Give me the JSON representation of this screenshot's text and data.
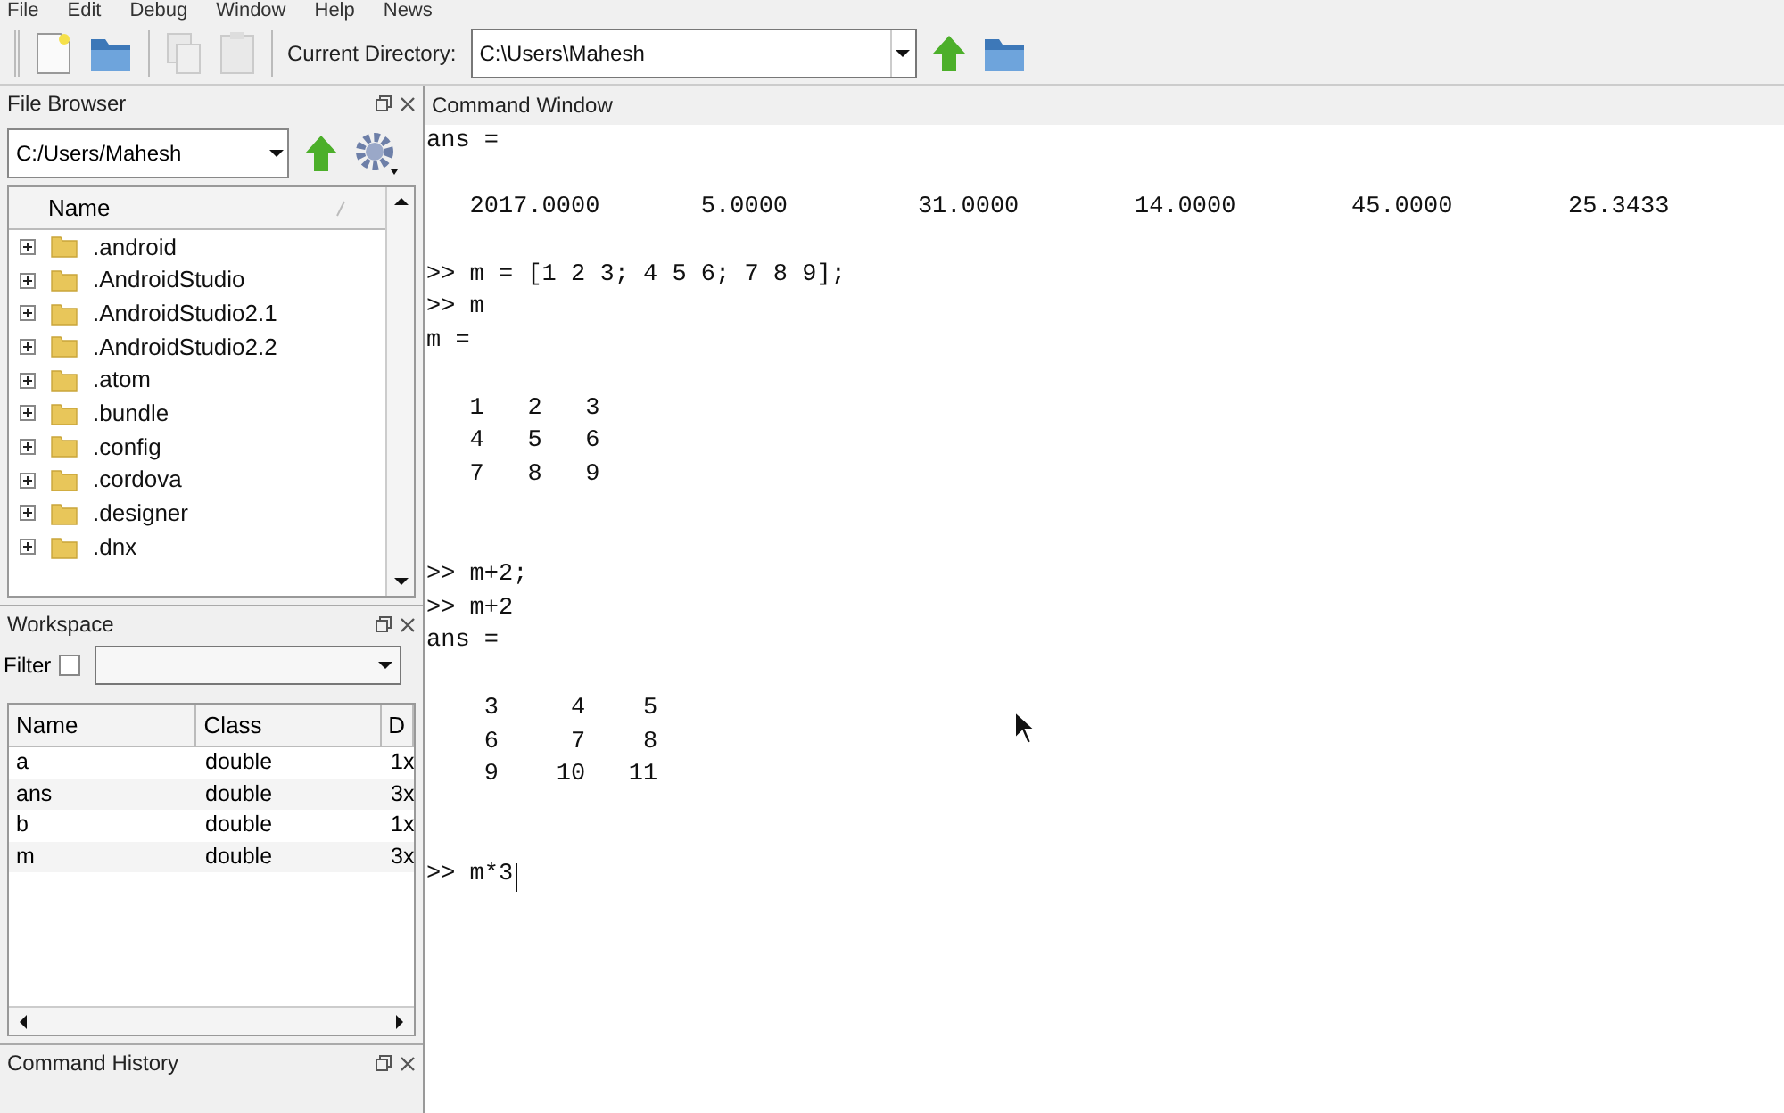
{
  "menu": [
    "File",
    "Edit",
    "Debug",
    "Window",
    "Help",
    "News"
  ],
  "toolbar": {
    "buttons": [
      {
        "kind": "new",
        "disabled": false
      },
      {
        "kind": "open",
        "disabled": false
      },
      {
        "kind": "copy",
        "disabled": true
      },
      {
        "kind": "paste",
        "disabled": true
      }
    ],
    "directory_label": "Current Directory:",
    "directory": "C:\\Users\\Mahesh"
  },
  "file_browser": {
    "title": "File Browser",
    "path": "C:/Users/Mahesh",
    "column": "Name",
    "items": [
      {
        "name": ".android",
        "expanded": false
      },
      {
        "name": ".AndroidStudio",
        "expanded": false
      },
      {
        "name": ".AndroidStudio2.1",
        "expanded": false
      },
      {
        "name": ".AndroidStudio2.2",
        "expanded": false
      },
      {
        "name": ".atom",
        "expanded": false
      },
      {
        "name": ".bundle",
        "expanded": false
      },
      {
        "name": ".config",
        "expanded": false
      },
      {
        "name": ".cordova",
        "expanded": false
      },
      {
        "name": ".designer",
        "expanded": false
      },
      {
        "name": ".dnx",
        "expanded": false
      }
    ]
  },
  "workspace": {
    "title": "Workspace",
    "filter_label": "Filter",
    "filter_checked": false,
    "columns": [
      "Name",
      "Class",
      "D"
    ],
    "rows": [
      [
        "a",
        "double",
        "1x"
      ],
      [
        "ans",
        "double",
        "3x"
      ],
      [
        "b",
        "double",
        "1x"
      ],
      [
        "m",
        "double",
        "3x"
      ]
    ]
  },
  "command_history": {
    "title": "Command History"
  },
  "command_window": {
    "title": "Command Window",
    "blocks": [
      {
        "kind": "text",
        "lines": [
          "ans ="
        ]
      },
      {
        "kind": "text",
        "lines": [
          "   2017.0000       5.0000         31.0000        14.0000        45.0000        25.3433"
        ]
      },
      {
        "kind": "text",
        "lines": [
          ">> m = [1 2 3; 4 5 6; 7 8 9];",
          ">> m",
          "m ="
        ]
      },
      {
        "kind": "matrix",
        "lines": [
          "   1   2   3",
          "   4   5   6",
          "   7   8   9"
        ]
      },
      {
        "kind": "text",
        "lines": [
          ">> m+2;",
          ">> m+2",
          "ans ="
        ]
      },
      {
        "kind": "matrix",
        "lines": [
          "    3     4    5",
          "    6     7    8",
          "    9    10   11"
        ]
      },
      {
        "kind": "prompt",
        "lines": [
          ">> m*3"
        ]
      }
    ]
  }
}
